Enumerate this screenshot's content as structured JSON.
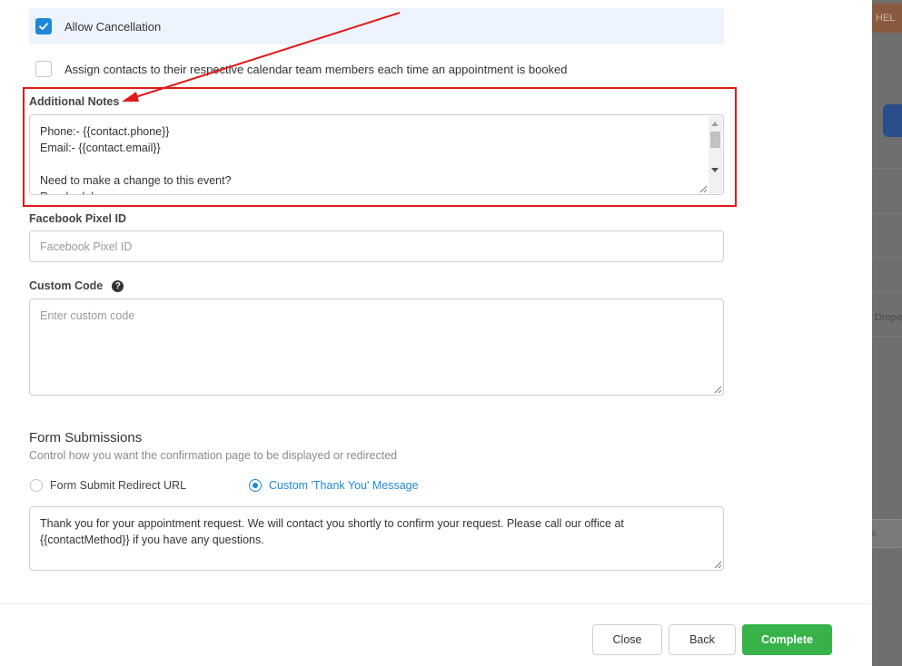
{
  "background": {
    "help_fragment": "HEL",
    "side_text": "Drope",
    "side_box_text": "s"
  },
  "options": {
    "allow_cancellation": {
      "label": "Allow Cancellation",
      "checked": true
    },
    "assign_contacts": {
      "label": "Assign contacts to their respective calendar team members each time an appointment is booked",
      "checked": false
    }
  },
  "additional_notes": {
    "label": "Additional Notes",
    "lines": [
      "Phone:- {{contact.phone}}",
      "Email:- {{contact.email}}",
      "",
      "Need to make a change to this event?",
      "Reschedule:"
    ]
  },
  "facebook_pixel": {
    "label": "Facebook Pixel ID",
    "placeholder": "Facebook Pixel ID",
    "value": ""
  },
  "custom_code": {
    "label": "Custom Code",
    "placeholder": "Enter custom code",
    "help_glyph": "?"
  },
  "form_submissions": {
    "title": "Form Submissions",
    "subtitle": "Control how you want the confirmation page to be displayed or redirected",
    "options": [
      {
        "label": "Form Submit Redirect URL",
        "selected": false
      },
      {
        "label": "Custom 'Thank You' Message",
        "selected": true
      }
    ],
    "message": "Thank you for your appointment request. We will contact you shortly to confirm your request. Please call our office at {{contactMethod}} if you have any questions."
  },
  "footer": {
    "close_label": "Close",
    "back_label": "Back",
    "complete_label": "Complete"
  },
  "colors": {
    "primary": "#1f88d6",
    "success": "#37b34a",
    "annotation": "#e01a1a"
  }
}
